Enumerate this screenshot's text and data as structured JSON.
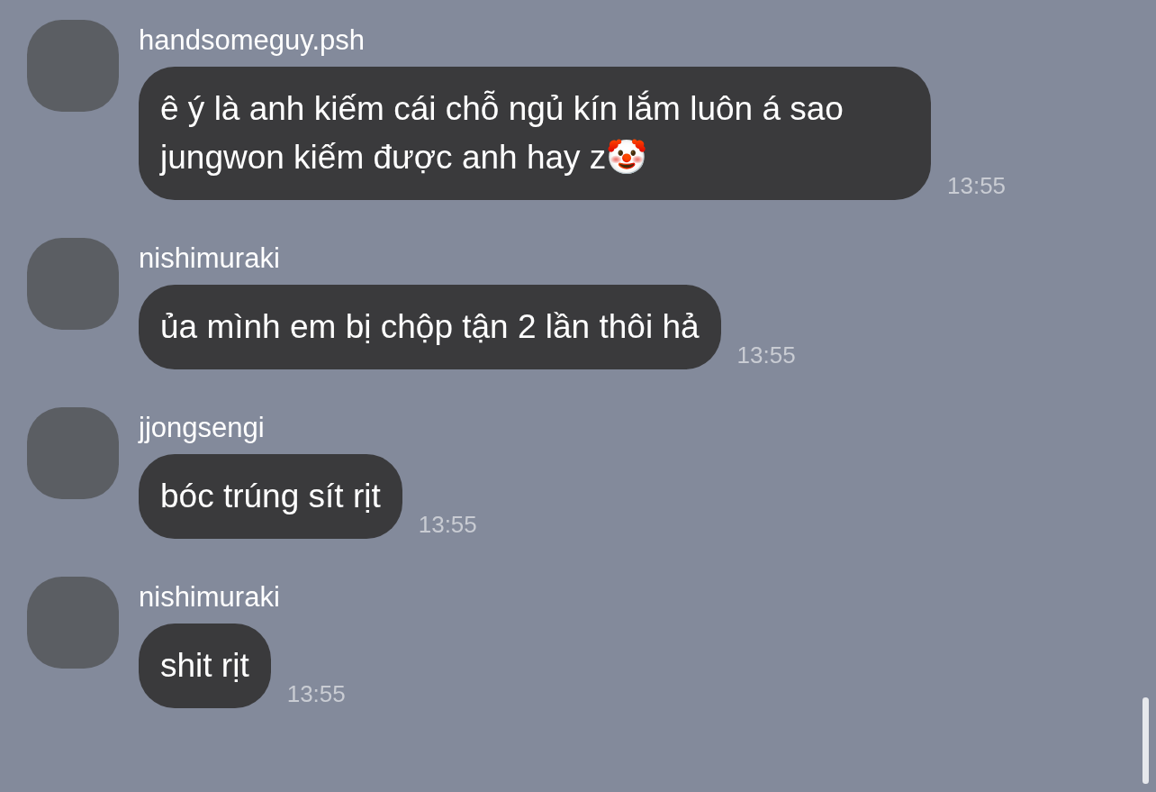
{
  "messages": [
    {
      "sender": "handsomeguy.psh",
      "text": "ê ý là anh kiếm cái chỗ ngủ kín lắm luôn á sao jungwon kiếm được anh hay z🤡",
      "time": "13:55"
    },
    {
      "sender": "nishimuraki",
      "text": "ủa mình em bị chộp tận 2 lần thôi hả",
      "time": "13:55"
    },
    {
      "sender": "jjongsengi",
      "text": "bóc trúng sít rịt",
      "time": "13:55"
    },
    {
      "sender": "nishimuraki",
      "text": "shit rịt",
      "time": "13:55"
    }
  ]
}
